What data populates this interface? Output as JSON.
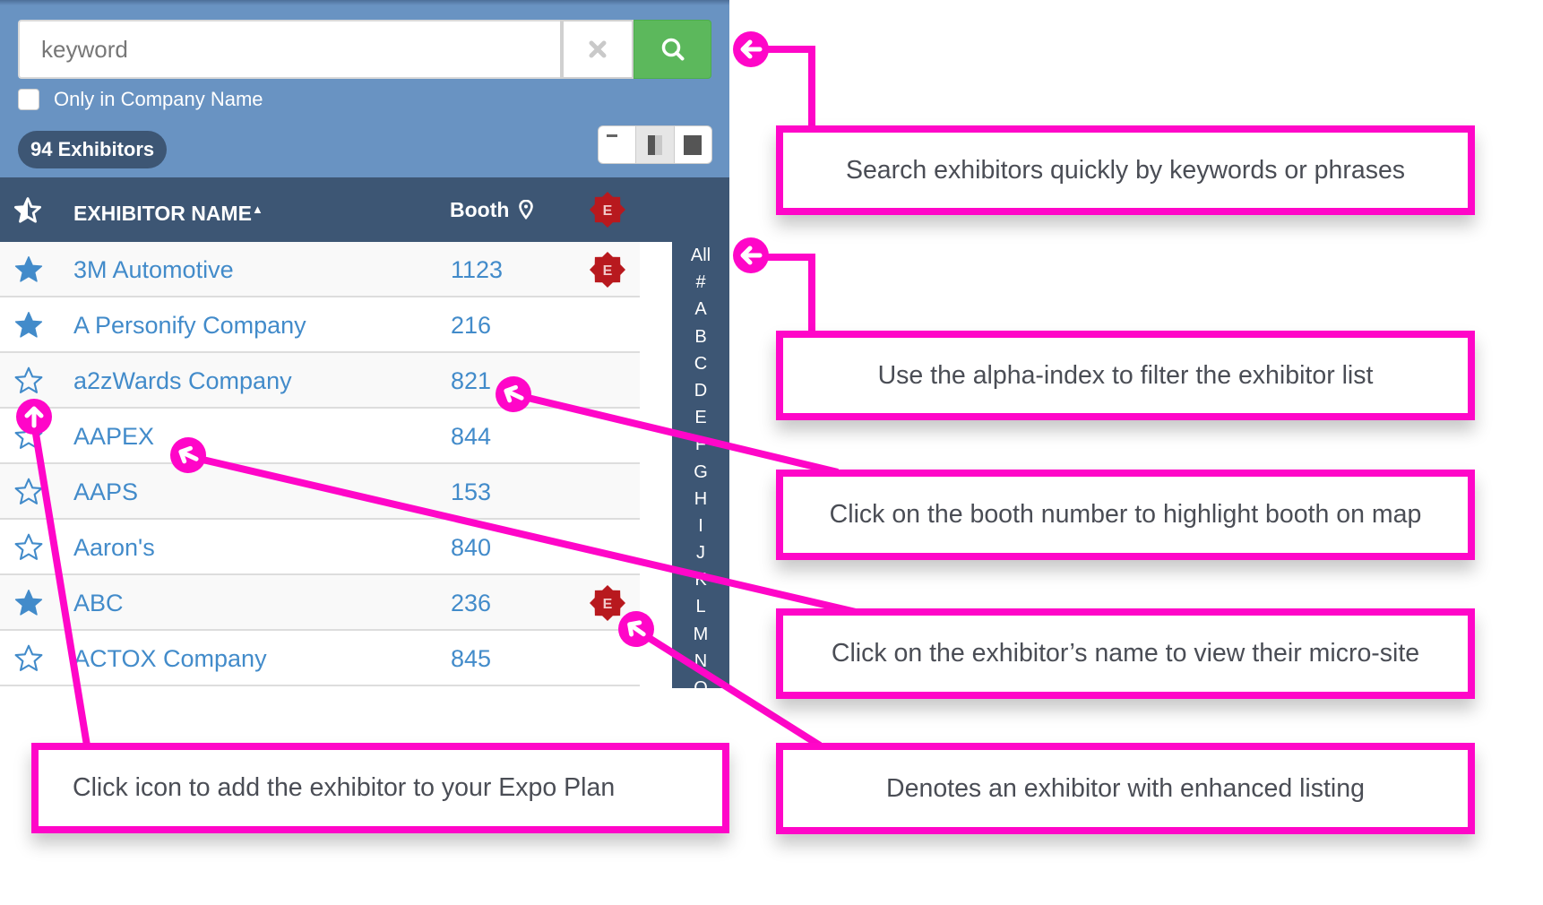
{
  "search": {
    "placeholder": "keyword",
    "clear_icon": "close-icon",
    "search_icon": "search-icon",
    "only_in_company_label": "Only in Company Name",
    "only_in_company_checked": false
  },
  "summary": {
    "exhibitor_count_label": "94 Exhibitors"
  },
  "view_toggle": {
    "options": [
      "list-view",
      "split-view",
      "map-view"
    ],
    "selected": "split-view"
  },
  "table": {
    "columns": {
      "favorite_icon": "star-outline-icon",
      "name": "EXHIBITOR NAME",
      "name_sort_indicator": "▲",
      "booth": "Booth",
      "booth_icon": "map-pin-icon",
      "enhanced_badge_letter": "E"
    },
    "rows": [
      {
        "name": "3M Automotive",
        "booth": "1123",
        "favorited": true,
        "enhanced": true
      },
      {
        "name": "A Personify Company",
        "booth": "216",
        "favorited": true,
        "enhanced": false
      },
      {
        "name": "a2zWards Company",
        "booth": "821",
        "favorited": false,
        "enhanced": false
      },
      {
        "name": "AAPEX",
        "booth": "844",
        "favorited": false,
        "enhanced": false
      },
      {
        "name": "AAPS",
        "booth": "153",
        "favorited": false,
        "enhanced": false
      },
      {
        "name": "Aaron's",
        "booth": "840",
        "favorited": false,
        "enhanced": false
      },
      {
        "name": "ABC",
        "booth": "236",
        "favorited": true,
        "enhanced": true
      },
      {
        "name": "ACTOX Company",
        "booth": "845",
        "favorited": false,
        "enhanced": false
      }
    ]
  },
  "alpha_index": [
    "All",
    "#",
    "A",
    "B",
    "C",
    "D",
    "E",
    "F",
    "G",
    "H",
    "I",
    "J",
    "K",
    "L",
    "M",
    "N",
    "O"
  ],
  "callouts": {
    "search": "Search exhibitors quickly by keywords or phrases",
    "alpha_index": "Use the alpha-index to filter the exhibitor list",
    "booth": "Click on the booth number to highlight booth on map",
    "name": "Click on the exhibitor’s name to view their micro-site",
    "enhanced": "Denotes an exhibitor with enhanced listing",
    "favorite": "Click icon to add the exhibitor to your Expo Plan"
  },
  "colors": {
    "panel_blue": "#6993c2",
    "header_navy": "#3d5674",
    "link_blue": "#428bca",
    "search_green": "#5cb85c",
    "badge_red": "#b8191e",
    "annotation_magenta": "#ff06c8"
  }
}
